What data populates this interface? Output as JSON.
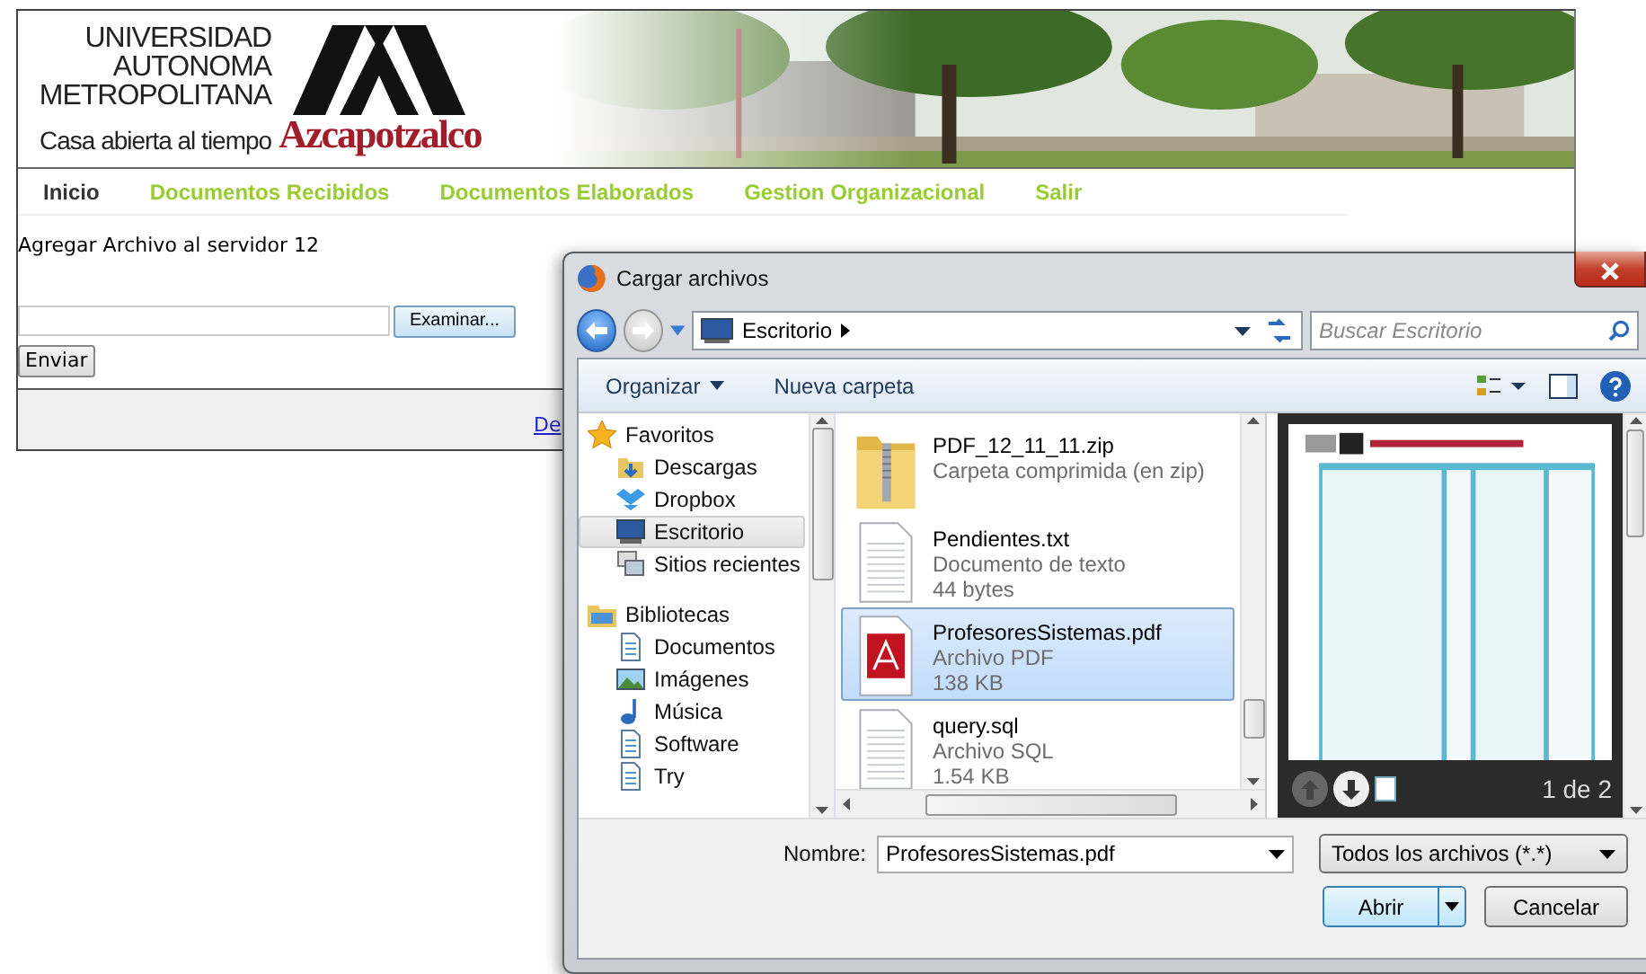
{
  "page": {
    "logo": {
      "line_1": "UNIVERSIDAD",
      "line_2": "AUTONOMA",
      "line_3": "METROPOLITANA",
      "motto": "Casa abierta al tiempo",
      "campus": "Azcapotzalco"
    },
    "nav": [
      {
        "label": "Inicio",
        "selected": true
      },
      {
        "label": "Documentos Recibidos",
        "selected": false
      },
      {
        "label": "Documentos Elaborados",
        "selected": false
      },
      {
        "label": "Gestion Organizacional",
        "selected": false
      },
      {
        "label": "Salir",
        "selected": false
      }
    ],
    "heading": "Agregar Archivo al servidor 12",
    "browse_button": "Examinar...",
    "submit_button": "Enviar",
    "footer_link": "De"
  },
  "dialog": {
    "title": "Cargar archivos",
    "address": "Escritorio",
    "search": {
      "placeholder": "Buscar Escritorio"
    },
    "toolbar": {
      "organize": "Organizar",
      "new_folder": "Nueva carpeta"
    },
    "nav_pane": [
      {
        "label": "Favoritos",
        "kind": "star",
        "selected": false,
        "children": [
          {
            "label": "Descargas",
            "kind": "downloads",
            "selected": false
          },
          {
            "label": "Dropbox",
            "kind": "dropbox",
            "selected": false
          },
          {
            "label": "Escritorio",
            "kind": "desktop",
            "selected": true
          },
          {
            "label": "Sitios recientes",
            "kind": "recent",
            "selected": false
          }
        ]
      },
      {
        "label": "Bibliotecas",
        "kind": "library",
        "selected": false,
        "children": [
          {
            "label": "Documentos",
            "kind": "documents",
            "selected": false
          },
          {
            "label": "Imágenes",
            "kind": "images",
            "selected": false
          },
          {
            "label": "Música",
            "kind": "music",
            "selected": false
          },
          {
            "label": "Software",
            "kind": "documents",
            "selected": false
          },
          {
            "label": "Try",
            "kind": "documents",
            "selected": false
          }
        ]
      }
    ],
    "files": [
      {
        "name": "PDF_12_11_11.zip",
        "kind": "zip",
        "type": "Carpeta comprimida (en zip)",
        "selected": false
      },
      {
        "name": "Pendientes.txt",
        "kind": "text",
        "type": "Documento de texto",
        "size": "44 bytes",
        "selected": false
      },
      {
        "name": "ProfesoresSistemas.pdf",
        "kind": "pdf",
        "type": "Archivo PDF",
        "size": "138 KB",
        "selected": true
      },
      {
        "name": "query.sql",
        "kind": "text",
        "type": "Archivo SQL",
        "size": "1.54 KB",
        "selected": false
      }
    ],
    "preview": {
      "page_counter": "1 de 2"
    },
    "filename_label": "Nombre:",
    "filename": "ProfesoresSistemas.pdf",
    "file_type": "Todos los archivos (*.*)",
    "open_button": "Abrir",
    "cancel_button": "Cancelar"
  }
}
